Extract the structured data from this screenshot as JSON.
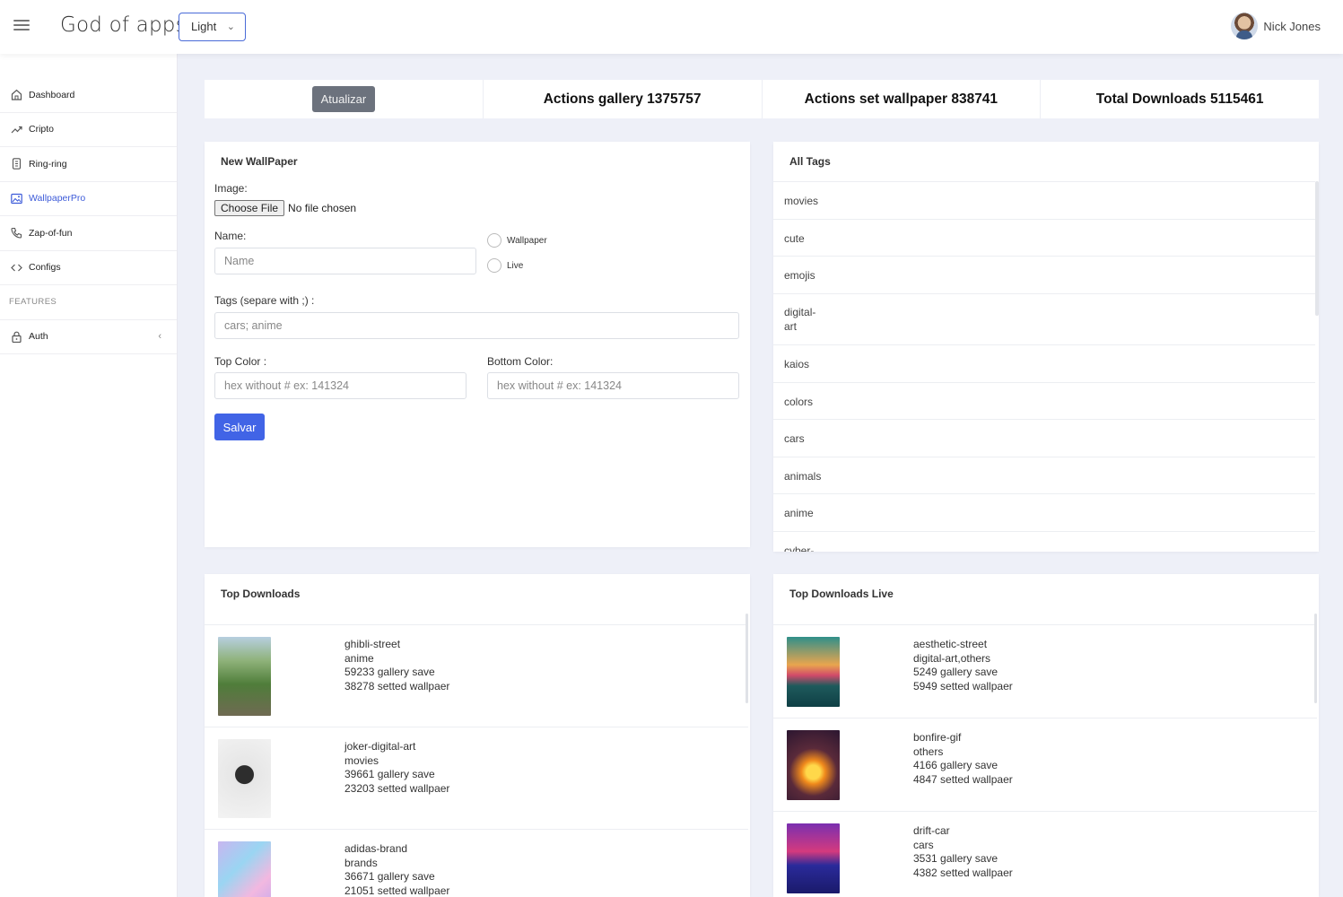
{
  "header": {
    "title": "God of apps",
    "theme_value": "Light",
    "user_name": "Nick Jones"
  },
  "sidebar": {
    "items": [
      {
        "label": "Dashboard",
        "icon": "home-icon"
      },
      {
        "label": "Cripto",
        "icon": "trend-icon"
      },
      {
        "label": "Ring-ring",
        "icon": "phone-device-icon"
      },
      {
        "label": "WallpaperPro",
        "icon": "image-icon",
        "active": true
      },
      {
        "label": "Zap-of-fun",
        "icon": "phone-call-icon"
      },
      {
        "label": "Configs",
        "icon": "code-icon"
      }
    ],
    "section_label": "FEATURES",
    "auth_label": "Auth"
  },
  "stats": {
    "update_button": "Atualizar",
    "actions_gallery": "Actions gallery 1375757",
    "actions_wallpaper": "Actions set wallpaper 838741",
    "total_downloads": "Total Downloads 5115461"
  },
  "new_wallpaper": {
    "title": "New WallPaper",
    "image_label": "Image:",
    "choose_file": "Choose File",
    "no_file": "No file chosen",
    "name_label": "Name:",
    "name_placeholder": "Name",
    "radio_wallpaper": "Wallpaper",
    "radio_live": "Live",
    "tags_label": "Tags (separe with ;) :",
    "tags_placeholder": "cars; anime",
    "top_color_label": "Top Color :",
    "top_color_placeholder": "hex without # ex: 141324",
    "bottom_color_label": "Bottom Color:",
    "bottom_color_placeholder": "hex without # ex: 141324",
    "save_button": "Salvar"
  },
  "all_tags": {
    "title": "All Tags",
    "tags": [
      "movies",
      "cute",
      "emojis",
      "digital-\nart",
      "kaios",
      "colors",
      "cars",
      "animals",
      "anime",
      "cyber-"
    ]
  },
  "top_downloads": {
    "title": "Top Downloads",
    "items": [
      {
        "name": "ghibli-street",
        "tags": "anime",
        "gallery": "59233 gallery save",
        "setted": "38278 setted wallpaer"
      },
      {
        "name": "joker-digital-art",
        "tags": "movies",
        "gallery": "39661 gallery save",
        "setted": "23203 setted wallpaer"
      },
      {
        "name": "adidas-brand",
        "tags": "brands",
        "gallery": "36671 gallery save",
        "setted": "21051 setted wallpaer"
      }
    ]
  },
  "top_downloads_live": {
    "title": "Top Downloads Live",
    "items": [
      {
        "name": "aesthetic-street",
        "tags": "digital-art,others",
        "gallery": "5249 gallery save",
        "setted": "5949 setted wallpaer"
      },
      {
        "name": "bonfire-gif",
        "tags": "others",
        "gallery": "4166 gallery save",
        "setted": "4847 setted wallpaer"
      },
      {
        "name": "drift-car",
        "tags": "cars",
        "gallery": "3531 gallery save",
        "setted": "4382 setted wallpaer"
      }
    ]
  },
  "colors": {
    "accent": "#4164e6",
    "active_nav": "#3d5bd9",
    "update_button": "#6c727d",
    "background": "#eef0f8"
  }
}
